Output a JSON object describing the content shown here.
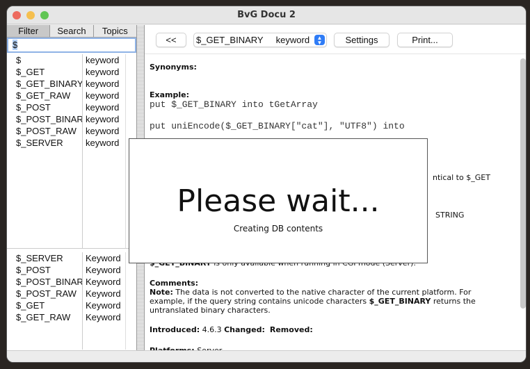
{
  "window": {
    "title": "BvG Docu 2"
  },
  "left": {
    "tabs": [
      "Filter",
      "Search",
      "Topics"
    ],
    "filter_value": "$",
    "results": [
      {
        "name": "$",
        "type": "keyword"
      },
      {
        "name": "$_GET",
        "type": "keyword"
      },
      {
        "name": "$_GET_BINARY",
        "type": "keyword"
      },
      {
        "name": "$_GET_RAW",
        "type": "keyword"
      },
      {
        "name": "$_POST",
        "type": "keyword"
      },
      {
        "name": "$_POST_BINARY",
        "type": "keyword"
      },
      {
        "name": "$_POST_RAW",
        "type": "keyword"
      },
      {
        "name": "$_SERVER",
        "type": "keyword"
      }
    ],
    "related": [
      {
        "name": "$_SERVER",
        "type": "Keyword"
      },
      {
        "name": "$_POST",
        "type": "Keyword"
      },
      {
        "name": "$_POST_BINARY",
        "type": "Keyword"
      },
      {
        "name": "$_POST_RAW",
        "type": "Keyword"
      },
      {
        "name": "$_GET",
        "type": "Keyword"
      },
      {
        "name": "$_GET_RAW",
        "type": "Keyword"
      }
    ]
  },
  "toolbar": {
    "back_label": "<<",
    "entry_name": "$_GET_BINARY",
    "entry_type": "keyword",
    "settings_label": "Settings",
    "print_label": "Print..."
  },
  "doc": {
    "synonyms_label": "Synonyms:",
    "example_label": "Example:",
    "example_line1": "put $_GET_BINARY into tGetArray",
    "example_line2": "put uniEncode($_GET_BINARY[\"cat\"], \"UTF8\") into",
    "fragment1": "ntical to $_GET",
    "fragment2": "STRING",
    "availability_term": "$_GET_BINARY",
    "availability_text": " is only available when running in CGI mode (Server).",
    "comments_label": "Comments:",
    "note_label": "Note:",
    "note_text1": " The data is not converted to the native character of the current platform. For example, if the query string contains unicode characters ",
    "note_term": "$_GET_BINARY",
    "note_text2": " returns the untranslated binary characters.",
    "introduced_label": "Introduced:",
    "introduced_value": " 4.6.3 ",
    "changed_label": "Changed:",
    "removed_label": "Removed:",
    "platforms_label": "Platforms:",
    "platforms_value": " Server"
  },
  "dialog": {
    "title": "Please wait...",
    "message": "Creating DB contents"
  },
  "colors": {
    "accent": "#2f7cf6",
    "close": "#ed6a5e",
    "minimize": "#f5bf4f",
    "zoom": "#61c554"
  }
}
